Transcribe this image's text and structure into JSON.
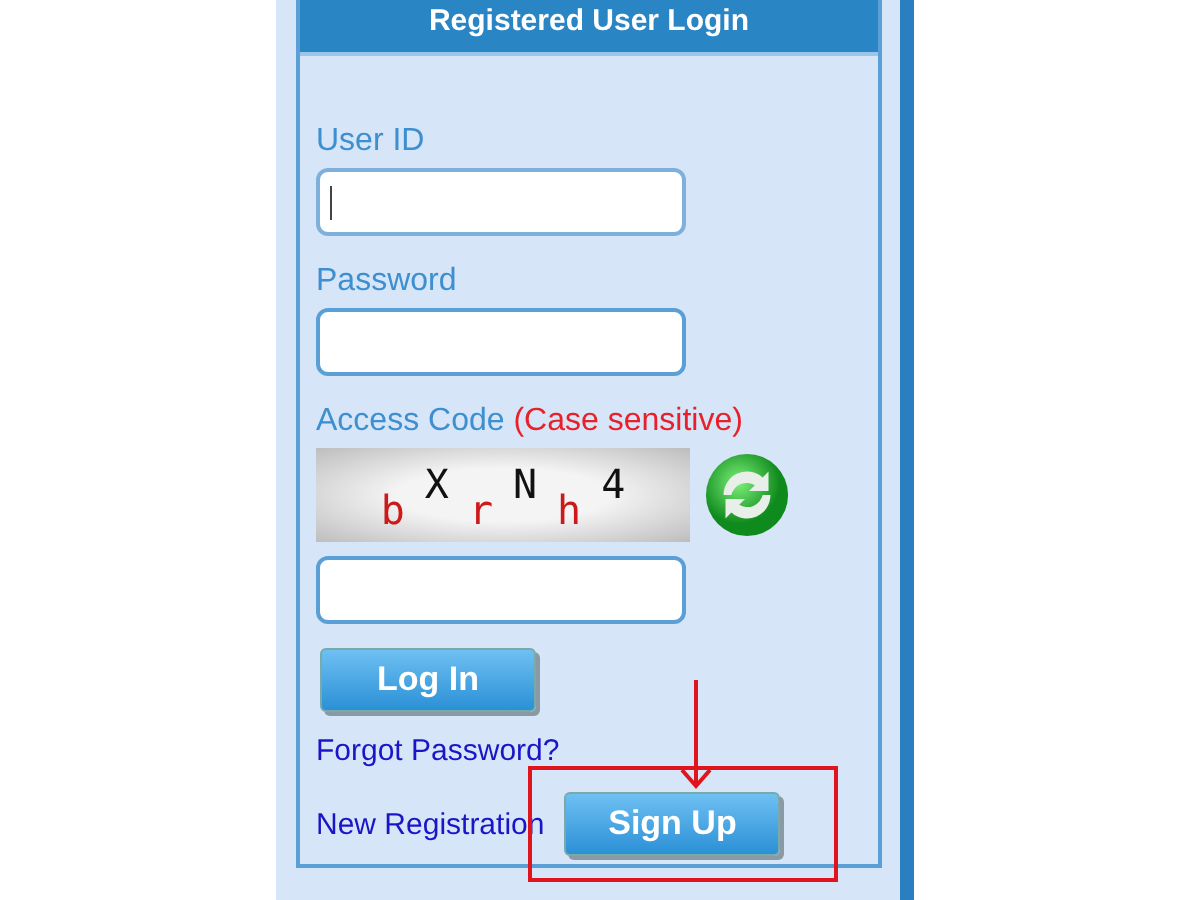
{
  "panel": {
    "title": "Registered User Login"
  },
  "fields": [
    {
      "label": "User ID",
      "focused": true
    },
    {
      "label": "Password",
      "focused": false
    }
  ],
  "access_code": {
    "label": "Access Code",
    "note": "(Case sensitive)",
    "captcha": [
      {
        "char": "b",
        "color": "#cc1a1a"
      },
      {
        "char": "X",
        "color": "#111111"
      },
      {
        "char": "r",
        "color": "#cc1a1a"
      },
      {
        "char": "N",
        "color": "#111111"
      },
      {
        "char": "h",
        "color": "#cc1a1a"
      },
      {
        "char": "4",
        "color": "#111111"
      }
    ]
  },
  "login_button": "Log In",
  "forgot_link": "Forgot Password?",
  "registration": {
    "label": "New Registration",
    "button": "Sign Up"
  },
  "annotation": {
    "kind": "arrow-with-box"
  }
}
